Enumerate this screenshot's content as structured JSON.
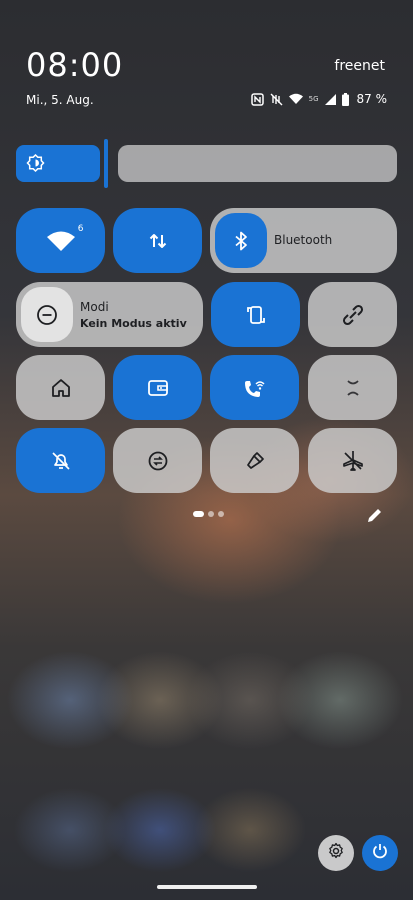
{
  "status": {
    "time": "08:00",
    "carrier": "freenet",
    "date": "Mi., 5. Aug.",
    "network": "5G",
    "battery": "87 %"
  },
  "brightness": {
    "level": 0.23
  },
  "tiles": {
    "wifi": {
      "badge": "6",
      "state": "on"
    },
    "data": {
      "state": "on"
    },
    "bluetooth": {
      "label": "Bluetooth",
      "state": "on"
    },
    "modes": {
      "label": "Modi",
      "sub": "Kein Modus aktiv",
      "state": "off"
    },
    "autorotate": {
      "state": "on"
    },
    "shortcut": {
      "state": "off"
    },
    "home": {
      "state": "off"
    },
    "wallet": {
      "state": "on"
    },
    "wifi_calling": {
      "state": "on"
    },
    "hotspot": {
      "state": "off"
    },
    "mute": {
      "state": "on"
    },
    "data_saver": {
      "state": "off"
    },
    "flashlight": {
      "state": "off"
    },
    "airplane": {
      "state": "off"
    }
  },
  "pager": {
    "pages": 3,
    "current": 1
  },
  "colors": {
    "accent": "#1a73d4",
    "tile_off": "#cdcdcd",
    "tile_icon_off": "#1e1f22"
  }
}
